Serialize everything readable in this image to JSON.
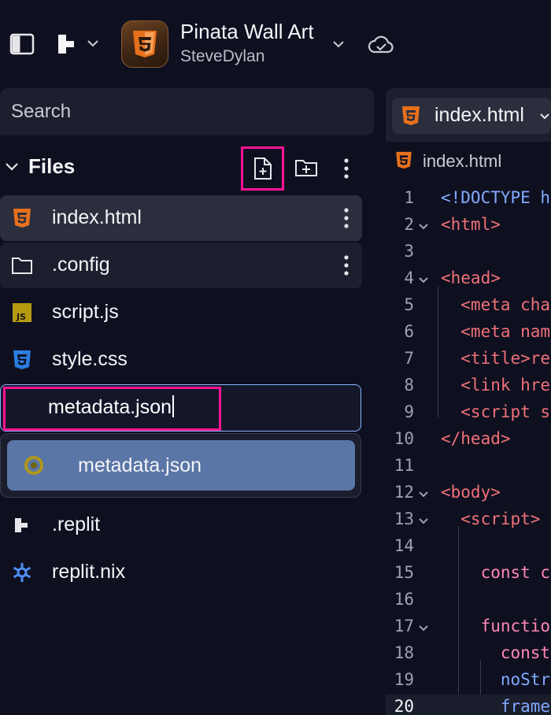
{
  "topbar": {
    "app_title": "Pinata Wall Art",
    "app_owner": "SteveDylan"
  },
  "sidebar": {
    "search_placeholder": "Search",
    "files_label": "Files",
    "files": [
      {
        "name": "index.html",
        "icon": "html5-icon"
      },
      {
        "name": ".config",
        "icon": "folder-icon"
      },
      {
        "name": "script.js",
        "icon": "javascript-icon"
      },
      {
        "name": "style.css",
        "icon": "css3-icon"
      },
      {
        "name": ".replit",
        "icon": "replit-icon"
      },
      {
        "name": "replit.nix",
        "icon": "nix-icon"
      }
    ],
    "rename_value": "metadata.json",
    "suggestion": "metadata.json"
  },
  "editor": {
    "tab_label": "index.html",
    "breadcrumb": "index.html",
    "line_numbers": [
      "1",
      "2",
      "3",
      "4",
      "5",
      "6",
      "7",
      "8",
      "9",
      "10",
      "11",
      "12",
      "13",
      "14",
      "15",
      "16",
      "17",
      "18",
      "19",
      "20"
    ],
    "lines": [
      "<!DOCTYPE h",
      "<html>",
      "",
      "<head>",
      "  <meta cha",
      "  <meta nam",
      "  <title>re",
      "  <link hre",
      "  <script s",
      "</head>",
      "",
      "<body>",
      "  <script>",
      "",
      "    const c",
      "",
      "    functio",
      "      const",
      "      noStr",
      "      frame"
    ]
  },
  "colors": {
    "accent_highlight": "#ff1493",
    "suggestion_bg": "#5a76a7",
    "background": "#0e1020"
  }
}
